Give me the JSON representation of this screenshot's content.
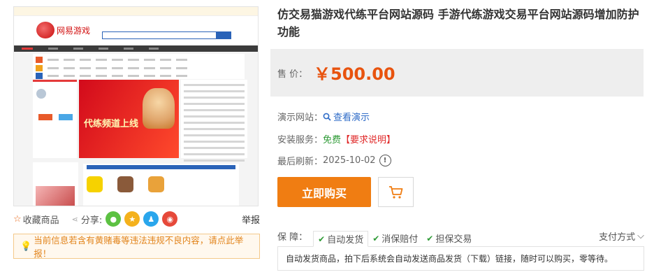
{
  "product": {
    "title": "仿交易猫游戏代练平台网站源码 手游代练游戏交易平台网站源码增加防护功能",
    "price_label": "售  价：",
    "price": "￥500.00"
  },
  "screenshot": {
    "logo_text": "网易游戏",
    "banner_title": "代练频道上线"
  },
  "share_bar": {
    "favorite_label": "收藏商品",
    "share_label": "分享:",
    "report_label": "举报"
  },
  "notice": {
    "text": "当前信息若含有黄赌毒等违法违规不良内容，请点此举报！"
  },
  "info": {
    "demo_label": "演示网站：",
    "demo_link": "查看演示",
    "service_label": "安装服务：",
    "service_value": "免费",
    "service_note": "【要求说明】",
    "refresh_label": "最后刷新：",
    "refresh_value": "2025-10-02"
  },
  "actions": {
    "buy_label": "立即购买"
  },
  "guarantee": {
    "label": "保  障：",
    "tabs": [
      "自动发货",
      "消保赔付",
      "担保交易"
    ],
    "payment_label": "支付方式",
    "description": "自动发货商品，拍下后系统会自动发送商品发货（下载）链接，随时可以购买，零等待。"
  },
  "colors": {
    "price": "#e8530e",
    "buy_button": "#f07d12",
    "link": "#2f6cc8",
    "free": "#2f9b37",
    "note": "#e02a2a",
    "notice": "#e2841c"
  }
}
